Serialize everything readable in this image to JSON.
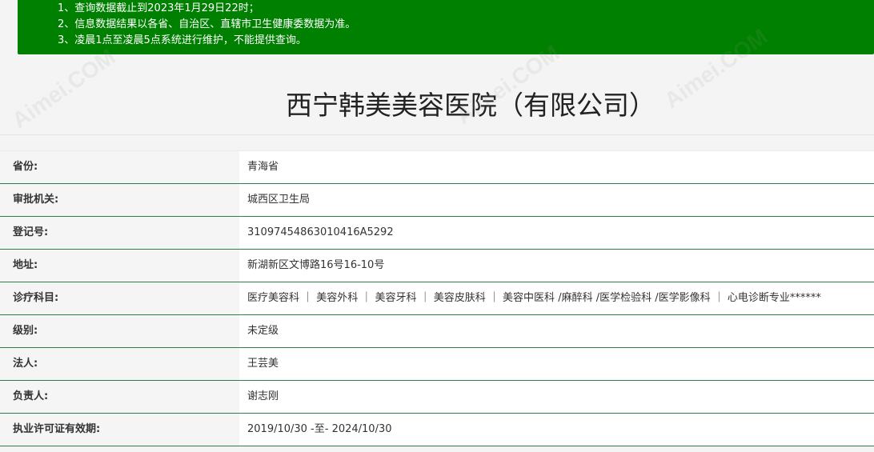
{
  "notice": {
    "lines": [
      "1、查询数据截止到2023年1月29日22时；",
      "2、信息数据结果以各省、自治区、直辖市卫生健康委数据为准。",
      "3、凌晨1点至凌晨5点系统进行维护，不能提供查询。"
    ]
  },
  "title": "西宁韩美美容医院（有限公司）",
  "rows": [
    {
      "label": "省份:",
      "value": "青海省"
    },
    {
      "label": "审批机关:",
      "value": "城西区卫生局"
    },
    {
      "label": "登记号:",
      "value": "31097454863010416A5292"
    },
    {
      "label": "地址:",
      "value": "新湖新区文博路16号16-10号"
    },
    {
      "label": "诊疗科目:",
      "value": "医疗美容科 ｜ 美容外科 ｜ 美容牙科 ｜ 美容皮肤科 ｜ 美容中医科 /麻醉科 /医学检验科 /医学影像科 ｜ 心电诊断专业******"
    },
    {
      "label": "级别:",
      "value": "未定级"
    },
    {
      "label": "法人:",
      "value": "王芸美"
    },
    {
      "label": "负责人:",
      "value": "谢志刚"
    },
    {
      "label": "执业许可证有效期:",
      "value": "2019/10/30 -至- 2024/10/30"
    }
  ],
  "watermark": "Aimei.COM",
  "colors": {
    "notice_bg": "#008000",
    "row_divider": "#2e7d4f"
  }
}
